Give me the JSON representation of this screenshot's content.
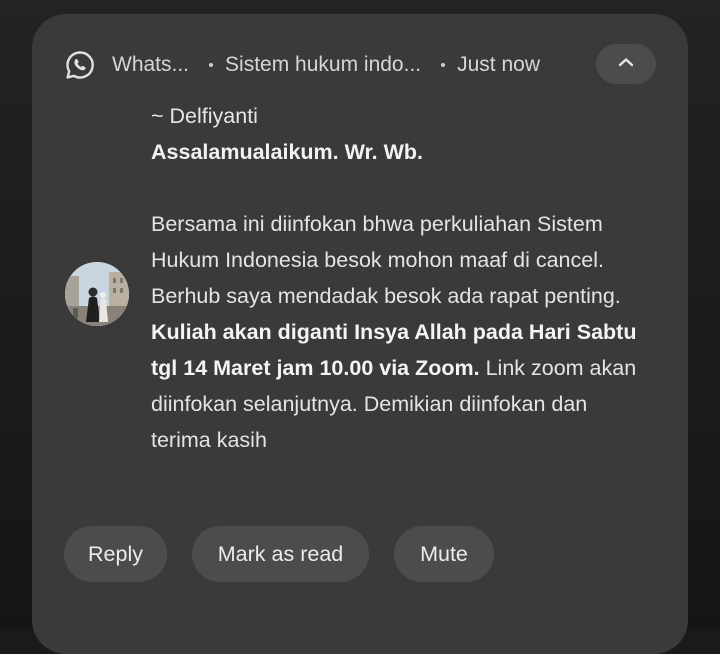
{
  "notification": {
    "app_name": "Whats...",
    "group_name": "Sistem hukum indo...",
    "timestamp": "Just now",
    "app_icon": "whatsapp-icon",
    "collapse_icon": "chevron-up-icon",
    "sender": "~ Delfiyanti",
    "greeting": "Assalamualaikum. Wr. Wb.",
    "message_part1": "Bersama ini diinfokan bhwa perkuliahan Sistem Hukum Indonesia besok mohon maaf di cancel. Berhub saya mendadak besok ada rapat penting. ",
    "message_bold": "Kuliah akan diganti Insya Allah pada Hari Sabtu tgl 14 Maret jam 10.00 via Zoom.",
    "message_part2": " Link zoom akan diinfokan selanjutnya. Demikian diinfokan dan terima kasih"
  },
  "actions": {
    "reply": "Reply",
    "mark_as_read": "Mark as read",
    "mute": "Mute"
  },
  "colors": {
    "card_bg": "#3a3a3a",
    "button_bg": "#4c4c4c",
    "text": "#e9e9e9"
  }
}
